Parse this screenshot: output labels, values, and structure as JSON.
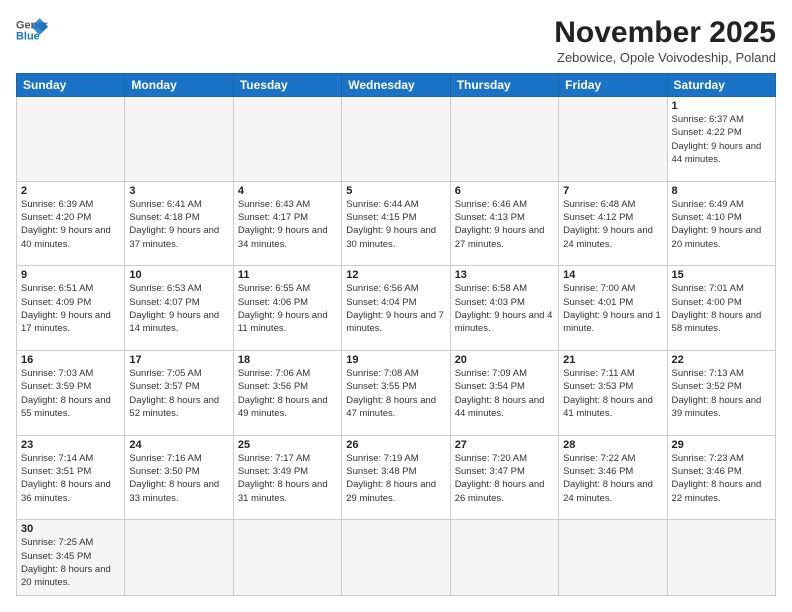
{
  "header": {
    "logo_general": "General",
    "logo_blue": "Blue",
    "month": "November 2025",
    "location": "Zebowice, Opole Voivodeship, Poland"
  },
  "days_of_week": [
    "Sunday",
    "Monday",
    "Tuesday",
    "Wednesday",
    "Thursday",
    "Friday",
    "Saturday"
  ],
  "weeks": [
    [
      {
        "day": "",
        "info": ""
      },
      {
        "day": "",
        "info": ""
      },
      {
        "day": "",
        "info": ""
      },
      {
        "day": "",
        "info": ""
      },
      {
        "day": "",
        "info": ""
      },
      {
        "day": "",
        "info": ""
      },
      {
        "day": "1",
        "info": "Sunrise: 6:37 AM\nSunset: 4:22 PM\nDaylight: 9 hours and 44 minutes."
      }
    ],
    [
      {
        "day": "2",
        "info": "Sunrise: 6:39 AM\nSunset: 4:20 PM\nDaylight: 9 hours and 40 minutes."
      },
      {
        "day": "3",
        "info": "Sunrise: 6:41 AM\nSunset: 4:18 PM\nDaylight: 9 hours and 37 minutes."
      },
      {
        "day": "4",
        "info": "Sunrise: 6:43 AM\nSunset: 4:17 PM\nDaylight: 9 hours and 34 minutes."
      },
      {
        "day": "5",
        "info": "Sunrise: 6:44 AM\nSunset: 4:15 PM\nDaylight: 9 hours and 30 minutes."
      },
      {
        "day": "6",
        "info": "Sunrise: 6:46 AM\nSunset: 4:13 PM\nDaylight: 9 hours and 27 minutes."
      },
      {
        "day": "7",
        "info": "Sunrise: 6:48 AM\nSunset: 4:12 PM\nDaylight: 9 hours and 24 minutes."
      },
      {
        "day": "8",
        "info": "Sunrise: 6:49 AM\nSunset: 4:10 PM\nDaylight: 9 hours and 20 minutes."
      }
    ],
    [
      {
        "day": "9",
        "info": "Sunrise: 6:51 AM\nSunset: 4:09 PM\nDaylight: 9 hours and 17 minutes."
      },
      {
        "day": "10",
        "info": "Sunrise: 6:53 AM\nSunset: 4:07 PM\nDaylight: 9 hours and 14 minutes."
      },
      {
        "day": "11",
        "info": "Sunrise: 6:55 AM\nSunset: 4:06 PM\nDaylight: 9 hours and 11 minutes."
      },
      {
        "day": "12",
        "info": "Sunrise: 6:56 AM\nSunset: 4:04 PM\nDaylight: 9 hours and 7 minutes."
      },
      {
        "day": "13",
        "info": "Sunrise: 6:58 AM\nSunset: 4:03 PM\nDaylight: 9 hours and 4 minutes."
      },
      {
        "day": "14",
        "info": "Sunrise: 7:00 AM\nSunset: 4:01 PM\nDaylight: 9 hours and 1 minute."
      },
      {
        "day": "15",
        "info": "Sunrise: 7:01 AM\nSunset: 4:00 PM\nDaylight: 8 hours and 58 minutes."
      }
    ],
    [
      {
        "day": "16",
        "info": "Sunrise: 7:03 AM\nSunset: 3:59 PM\nDaylight: 8 hours and 55 minutes."
      },
      {
        "day": "17",
        "info": "Sunrise: 7:05 AM\nSunset: 3:57 PM\nDaylight: 8 hours and 52 minutes."
      },
      {
        "day": "18",
        "info": "Sunrise: 7:06 AM\nSunset: 3:56 PM\nDaylight: 8 hours and 49 minutes."
      },
      {
        "day": "19",
        "info": "Sunrise: 7:08 AM\nSunset: 3:55 PM\nDaylight: 8 hours and 47 minutes."
      },
      {
        "day": "20",
        "info": "Sunrise: 7:09 AM\nSunset: 3:54 PM\nDaylight: 8 hours and 44 minutes."
      },
      {
        "day": "21",
        "info": "Sunrise: 7:11 AM\nSunset: 3:53 PM\nDaylight: 8 hours and 41 minutes."
      },
      {
        "day": "22",
        "info": "Sunrise: 7:13 AM\nSunset: 3:52 PM\nDaylight: 8 hours and 39 minutes."
      }
    ],
    [
      {
        "day": "23",
        "info": "Sunrise: 7:14 AM\nSunset: 3:51 PM\nDaylight: 8 hours and 36 minutes."
      },
      {
        "day": "24",
        "info": "Sunrise: 7:16 AM\nSunset: 3:50 PM\nDaylight: 8 hours and 33 minutes."
      },
      {
        "day": "25",
        "info": "Sunrise: 7:17 AM\nSunset: 3:49 PM\nDaylight: 8 hours and 31 minutes."
      },
      {
        "day": "26",
        "info": "Sunrise: 7:19 AM\nSunset: 3:48 PM\nDaylight: 8 hours and 29 minutes."
      },
      {
        "day": "27",
        "info": "Sunrise: 7:20 AM\nSunset: 3:47 PM\nDaylight: 8 hours and 26 minutes."
      },
      {
        "day": "28",
        "info": "Sunrise: 7:22 AM\nSunset: 3:46 PM\nDaylight: 8 hours and 24 minutes."
      },
      {
        "day": "29",
        "info": "Sunrise: 7:23 AM\nSunset: 3:46 PM\nDaylight: 8 hours and 22 minutes."
      }
    ],
    [
      {
        "day": "30",
        "info": "Sunrise: 7:25 AM\nSunset: 3:45 PM\nDaylight: 8 hours and 20 minutes."
      },
      {
        "day": "",
        "info": ""
      },
      {
        "day": "",
        "info": ""
      },
      {
        "day": "",
        "info": ""
      },
      {
        "day": "",
        "info": ""
      },
      {
        "day": "",
        "info": ""
      },
      {
        "day": "",
        "info": ""
      }
    ]
  ]
}
